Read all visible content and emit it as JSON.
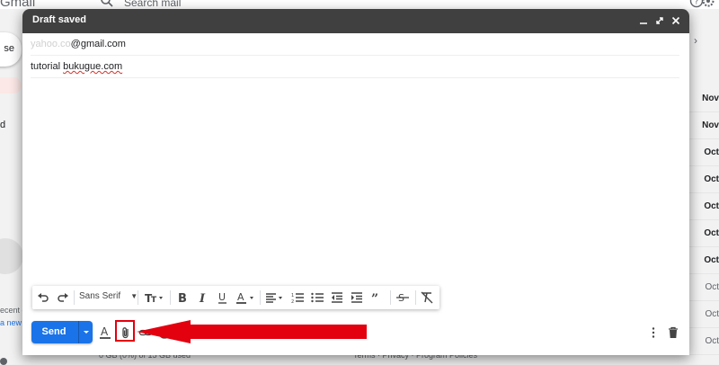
{
  "background": {
    "app_name": "Gmail",
    "search_placeholder": "Search mail",
    "compose_label": "se",
    "sidebar_letter": "d",
    "recent_text": "ecent c",
    "new_text": "a new",
    "dates": [
      "Nov",
      "Nov",
      "Oct",
      "Oct",
      "Oct",
      "Oct",
      "Oct",
      "Oct",
      "Oct",
      "Oct"
    ],
    "storage": "0 GB (0%) of 15 GB used",
    "footer": "Terms · Privacy · Program Policies"
  },
  "compose": {
    "title": "Draft saved",
    "to_masked": "yahoo.co",
    "to_domain": "@gmail.com",
    "subject_prefix": "tutorial ",
    "subject_link": "bukugue.com"
  },
  "toolbar": {
    "font": "Sans Serif",
    "icons": [
      "undo-icon",
      "redo-icon",
      "text-size-icon",
      "bold-icon",
      "italic-icon",
      "underline-icon",
      "text-color-icon",
      "align-icon",
      "numbered-list-icon",
      "bulleted-list-icon",
      "indent-less-icon",
      "indent-more-icon",
      "quote-icon",
      "strikethrough-icon",
      "remove-formatting-icon"
    ]
  },
  "footer_bar": {
    "send_label": "Send"
  },
  "colors": {
    "header_bg": "#404040",
    "send_bg": "#1a73e8",
    "annotation_red": "#e3000f"
  }
}
